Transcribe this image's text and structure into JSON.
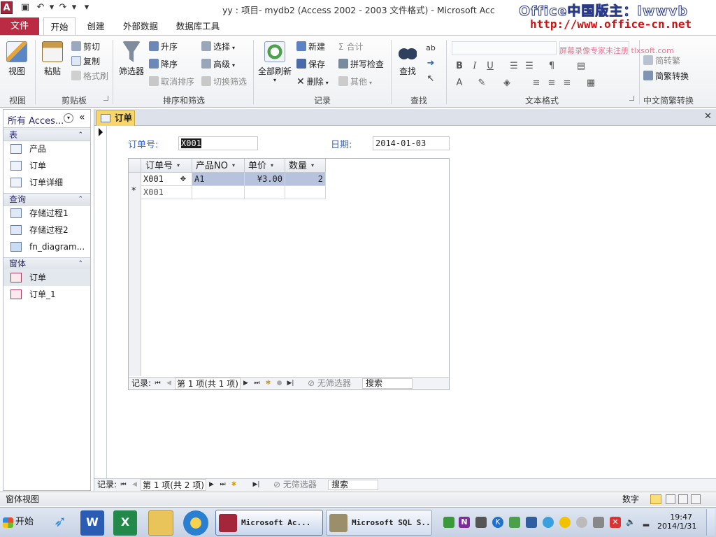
{
  "window": {
    "title": "yy : 项目- mydb2 (Access 2002 - 2003 文件格式)  -  Microsoft Acc",
    "app_logo": "A",
    "close_glyph": "✕"
  },
  "watermark": {
    "line1": "Office中国版主：lwwvb",
    "line2": "http://www.office-cn.net",
    "line3": "屏幕录像专家未注册 tlxsoft.com"
  },
  "tabs": [
    "文件",
    "开始",
    "创建",
    "外部数据",
    "数据库工具"
  ],
  "ribbon": {
    "view": {
      "button": "视图",
      "group": "视图"
    },
    "clipboard": {
      "paste": "粘贴",
      "cut": "剪切",
      "copy": "复制",
      "format_painter": "格式刷",
      "group": "剪贴板"
    },
    "sort_filter": {
      "filter": "筛选器",
      "ascending": "升序",
      "descending": "降序",
      "clear_sort": "取消排序",
      "selection": "选择",
      "advanced": "高级",
      "toggle_filter": "切换筛选",
      "group": "排序和筛选"
    },
    "records": {
      "refresh_all": "全部刷新",
      "new": "新建",
      "save": "保存",
      "delete": "删除",
      "totals": "合计",
      "spelling": "拼写检查",
      "more": "其他",
      "group": "记录"
    },
    "find": {
      "find": "查找",
      "group": "查找"
    },
    "text_format": {
      "group": "文本格式",
      "bold": "B",
      "italic": "I",
      "underline": "U"
    },
    "chinese_conv": {
      "to_traditional": "简转繁",
      "to_simplified": "简繁转换",
      "group": "中文简繁转换"
    }
  },
  "nav": {
    "header": "所有 Acces...",
    "sections": [
      {
        "title": "表",
        "items": [
          "产品",
          "订单",
          "订单详细"
        ]
      },
      {
        "title": "查询",
        "items": [
          "存储过程1",
          "存储过程2",
          "fn_diagram..."
        ]
      },
      {
        "title": "窗体",
        "items": [
          "订单",
          "订单_1"
        ]
      }
    ]
  },
  "document": {
    "tab_title": "订单",
    "order_no_label": "订单号:",
    "order_no_value": "X001",
    "date_label": "日期:",
    "date_value": "2014-01-03",
    "subform": {
      "columns": [
        "订单号",
        "产品NO",
        "单价",
        "数量"
      ],
      "rows": [
        [
          "X001",
          "A1",
          "¥3.00",
          "2"
        ]
      ],
      "new_row": {
        "marker": "*",
        "value": "X001"
      },
      "recbar": {
        "label": "记录:",
        "position": "第 1 项(共 1 项)",
        "no_filter": "无筛选器",
        "search": "搜索"
      }
    },
    "recbar": {
      "label": "记录:",
      "position": "第 1 项(共 2 项)",
      "no_filter": "无筛选器",
      "search": "搜索"
    }
  },
  "status": {
    "left": "窗体视图",
    "numlock": "数字"
  },
  "taskbar": {
    "start": "开始",
    "tasks": [
      "Microsoft Ac...",
      "Microsoft SQL S..."
    ],
    "time": "19:47",
    "date": "2014/1/31"
  }
}
